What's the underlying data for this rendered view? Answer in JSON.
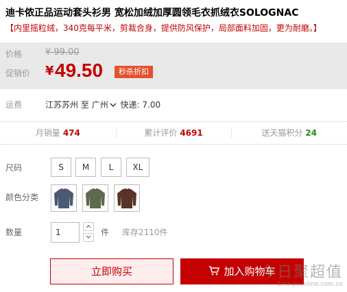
{
  "product": {
    "title": "迪卡侬正品运动套头衫男 宽松加绒加厚圆领毛衣抓绒衣SOLOGNAC",
    "subtitle": "【内里摇粒绒，340克每平米，剪裁合身，提供防风保护，局部面料加固，更为耐磨。】"
  },
  "price": {
    "original_label": "价格",
    "original_value": "¥ 99.00",
    "promo_label": "促销价",
    "currency": "¥",
    "promo_value": "49.50",
    "badge": "秒杀折扣"
  },
  "shipping": {
    "label": "运费",
    "from": "江苏苏州",
    "to_word": "至",
    "to": "广州",
    "express": "快递: 7.00"
  },
  "stats": [
    {
      "label": "月销量",
      "value": "474",
      "color": "#c40000"
    },
    {
      "label": "累计评价",
      "value": "4691",
      "color": "#c40000"
    },
    {
      "label": "送天猫积分",
      "value": "24",
      "color": "#1c8f1c"
    }
  ],
  "size": {
    "label": "尺码",
    "options": [
      "S",
      "M",
      "L",
      "XL"
    ]
  },
  "color": {
    "label": "颜色分类",
    "swatches": [
      {
        "icon": "sweater-navy-icon",
        "hex": "#4a5a74"
      },
      {
        "icon": "sweater-green-icon",
        "hex": "#5d6a4e"
      },
      {
        "icon": "sweater-brown-icon",
        "hex": "#5a3328"
      }
    ]
  },
  "quantity": {
    "label": "数量",
    "value": "1",
    "unit": "件",
    "stock": "库存2110件"
  },
  "actions": {
    "buy_now": "立即购买",
    "add_cart": "加入购物车"
  },
  "watermark": {
    "main": "今日聚超值",
    "sub": "best.pconline.com.cn"
  },
  "colors": {
    "accent": "#c40000",
    "badge": "#e5512f",
    "price_bg": "#e9e9e9"
  }
}
